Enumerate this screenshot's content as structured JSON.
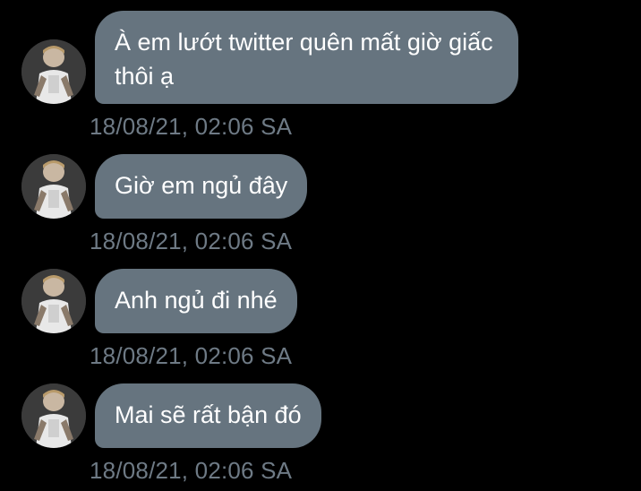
{
  "colors": {
    "background": "#000000",
    "bubble": "#66747f",
    "bubble_text": "#ffffff",
    "timestamp": "#6e7a85"
  },
  "messages": [
    {
      "text": "À em lướt twitter quên mất giờ giấc thôi ạ",
      "timestamp": "18/08/21, 02:06 SA",
      "avatar_icon": "user-photo-avatar"
    },
    {
      "text": "Giờ em ngủ đây",
      "timestamp": "18/08/21, 02:06 SA",
      "avatar_icon": "user-photo-avatar"
    },
    {
      "text": "Anh ngủ đi nhé",
      "timestamp": "18/08/21, 02:06 SA",
      "avatar_icon": "user-photo-avatar"
    },
    {
      "text": "Mai sẽ rất bận đó",
      "timestamp": "18/08/21, 02:06 SA",
      "avatar_icon": "user-photo-avatar"
    }
  ]
}
